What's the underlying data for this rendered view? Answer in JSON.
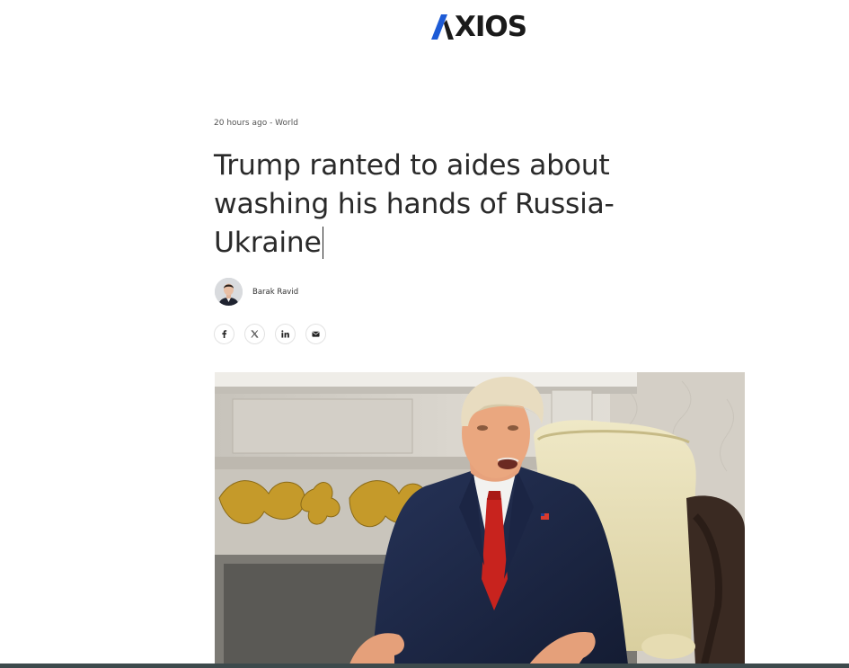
{
  "brand": {
    "name": "XIOS",
    "logo_icon": "axios-a-chevron-icon"
  },
  "article": {
    "meta": "20 hours ago - World",
    "headline": "Trump ranted to aides about washing his hands of Russia-Ukraine",
    "author": {
      "name": "Barak Ravid",
      "avatar_icon": "author-avatar"
    },
    "share": [
      {
        "name": "facebook",
        "icon": "facebook-icon",
        "glyph": "f"
      },
      {
        "name": "x",
        "icon": "x-icon",
        "glyph": "𝕏"
      },
      {
        "name": "linkedin",
        "icon": "linkedin-icon",
        "glyph": "in"
      },
      {
        "name": "email",
        "icon": "email-icon",
        "glyph": "✉"
      }
    ],
    "hero_image": "photo of man in dark suit and red tie seated in ornate room"
  },
  "colors": {
    "logo_accent": "#1d5bd6",
    "text": "#2a2a2a",
    "tie": "#c8231e",
    "suit": "#1c2747"
  }
}
